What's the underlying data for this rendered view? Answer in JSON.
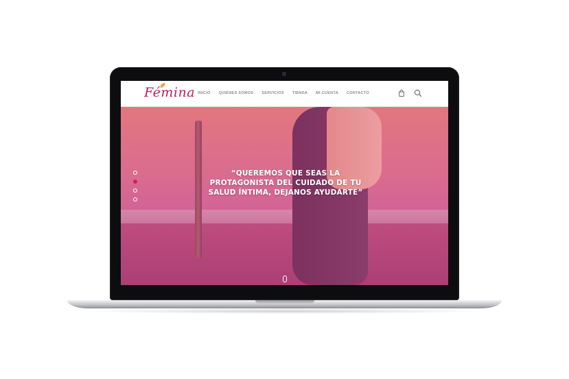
{
  "site": {
    "logo": "Fémina"
  },
  "nav": {
    "items": [
      {
        "label": "INICIO"
      },
      {
        "label": "QUIÉNES SOMOS"
      },
      {
        "label": "SERVICIOS"
      },
      {
        "label": "TIENDA"
      },
      {
        "label": "MI CUENTA"
      },
      {
        "label": "CONTACTO"
      }
    ]
  },
  "header_icons": {
    "cart": "cart-icon",
    "search": "search-icon"
  },
  "hero": {
    "quote": "“QUEREMOS QUE SEAS LA PROTAGONISTA DEL CUIDADO DE TU SALUD ÍNTIMA, DEJANOS AYUDARTE”",
    "slider": {
      "count": 4,
      "active_index": 1
    }
  },
  "colors": {
    "brand": "#c2185b",
    "accent": "#d81b60",
    "leaf": "#f2a23a"
  }
}
